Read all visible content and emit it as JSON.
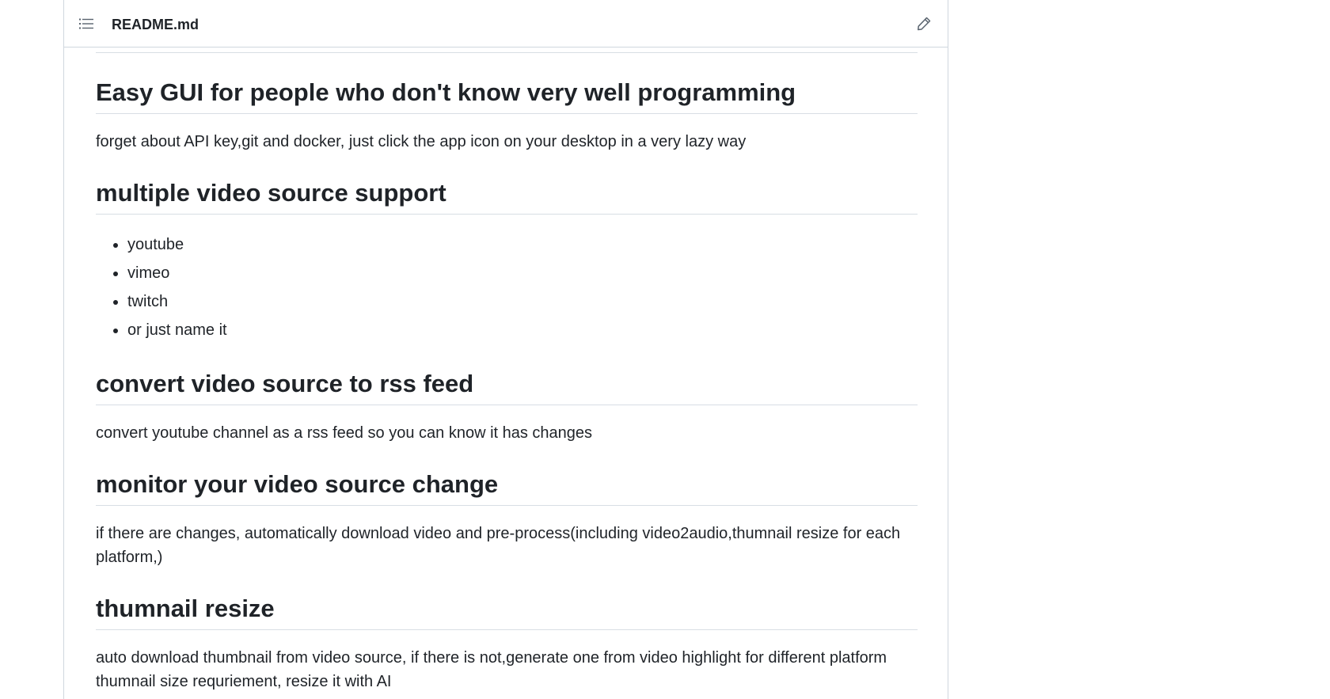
{
  "header": {
    "file_name": "README.md",
    "toc_icon": "list-icon",
    "edit_icon": "pencil-icon"
  },
  "sections": [
    {
      "heading": "Easy GUI for people who don't know very well programming",
      "paragraph": "forget about API key,git and docker, just click the app icon on your desktop in a very lazy way"
    },
    {
      "heading": "multiple video source support",
      "items": [
        "youtube",
        "vimeo",
        "twitch",
        "or just name it"
      ]
    },
    {
      "heading": "convert video source to rss feed",
      "paragraph": "convert youtube channel as a rss feed so you can know it has changes"
    },
    {
      "heading": "monitor your video source change",
      "paragraph": "if there are changes, automatically download video and pre-process(including video2audio,thumnail resize for each platform,)"
    },
    {
      "heading": "thumnail resize",
      "paragraph": "auto download thumbnail from video source, if there is not,generate one from video highlight for different platform thumnail size requriement, resize it with AI"
    }
  ],
  "colors": {
    "text": "#1f2328",
    "border": "#d0d7de",
    "icon": "#59636e"
  }
}
